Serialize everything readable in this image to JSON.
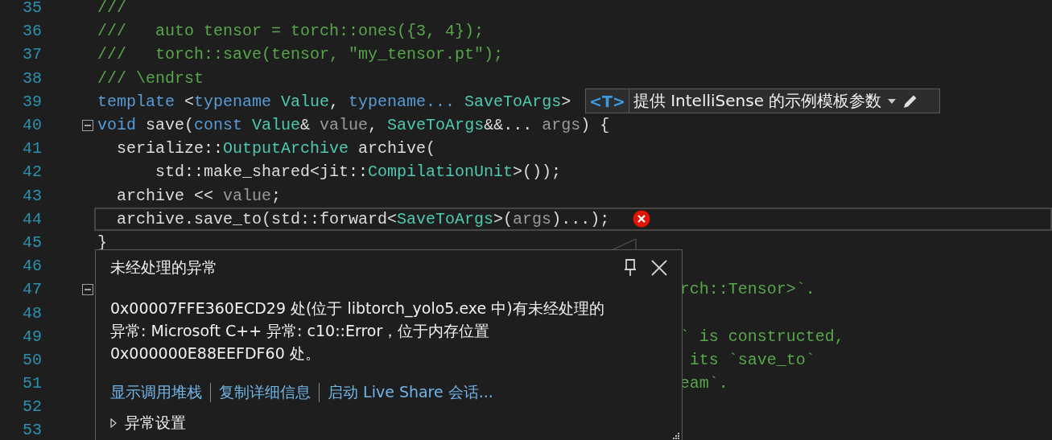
{
  "editor": {
    "lines": [
      {
        "number": "35",
        "current": false,
        "collapsible": false,
        "error": false,
        "tokens": [
          {
            "kind": "comment",
            "text": "///"
          }
        ]
      },
      {
        "number": "36",
        "current": false,
        "collapsible": false,
        "error": false,
        "tokens": [
          {
            "kind": "comment",
            "text": "///   auto tensor = torch::ones({3, 4});"
          }
        ]
      },
      {
        "number": "37",
        "current": false,
        "collapsible": false,
        "error": false,
        "tokens": [
          {
            "kind": "comment",
            "text": "///   torch::save(tensor, \"my_tensor.pt\");"
          }
        ]
      },
      {
        "number": "38",
        "current": false,
        "collapsible": false,
        "error": false,
        "tokens": [
          {
            "kind": "comment",
            "text": "/// \\endrst"
          }
        ]
      },
      {
        "number": "39",
        "current": false,
        "collapsible": false,
        "error": false,
        "tokens": [
          {
            "kind": "keyword",
            "text": "template"
          },
          {
            "kind": "plain",
            "text": " <"
          },
          {
            "kind": "keyword",
            "text": "typename"
          },
          {
            "kind": "type",
            "text": " Value"
          },
          {
            "kind": "plain",
            "text": ", "
          },
          {
            "kind": "keyword",
            "text": "typename..."
          },
          {
            "kind": "type",
            "text": " SaveToArgs"
          },
          {
            "kind": "plain",
            "text": ">"
          }
        ]
      },
      {
        "number": "40",
        "current": false,
        "collapsible": true,
        "error": false,
        "tokens": [
          {
            "kind": "keyword",
            "text": "void"
          },
          {
            "kind": "plain",
            "text": " save("
          },
          {
            "kind": "keyword",
            "text": "const"
          },
          {
            "kind": "type",
            "text": " Value"
          },
          {
            "kind": "plain",
            "text": "& "
          },
          {
            "kind": "param",
            "text": "value"
          },
          {
            "kind": "plain",
            "text": ", "
          },
          {
            "kind": "type",
            "text": "SaveToArgs"
          },
          {
            "kind": "plain",
            "text": "&&... "
          },
          {
            "kind": "param",
            "text": "args"
          },
          {
            "kind": "plain",
            "text": ") {"
          }
        ]
      },
      {
        "number": "41",
        "current": false,
        "collapsible": false,
        "error": false,
        "tokens": [
          {
            "kind": "plain",
            "text": "  serialize::"
          },
          {
            "kind": "type",
            "text": "OutputArchive"
          },
          {
            "kind": "plain",
            "text": " archive("
          }
        ]
      },
      {
        "number": "42",
        "current": false,
        "collapsible": false,
        "error": false,
        "tokens": [
          {
            "kind": "plain",
            "text": "      std::make_shared<jit::"
          },
          {
            "kind": "type",
            "text": "CompilationUnit"
          },
          {
            "kind": "plain",
            "text": ">());"
          }
        ]
      },
      {
        "number": "43",
        "current": false,
        "collapsible": false,
        "error": false,
        "tokens": [
          {
            "kind": "plain",
            "text": "  archive << "
          },
          {
            "kind": "param",
            "text": "value"
          },
          {
            "kind": "plain",
            "text": ";"
          }
        ]
      },
      {
        "number": "44",
        "current": true,
        "collapsible": false,
        "error": true,
        "tokens": [
          {
            "kind": "plain",
            "text": "  archive.save_to(std::forward<"
          },
          {
            "kind": "type",
            "text": "SaveToArgs"
          },
          {
            "kind": "plain",
            "text": ">("
          },
          {
            "kind": "param",
            "text": "args"
          },
          {
            "kind": "plain",
            "text": ")...);"
          }
        ]
      },
      {
        "number": "45",
        "current": false,
        "collapsible": false,
        "error": false,
        "tokens": [
          {
            "kind": "plain",
            "text": "}"
          }
        ]
      },
      {
        "number": "46",
        "current": false,
        "collapsible": false,
        "error": false
      },
      {
        "number": "47",
        "current": false,
        "collapsible": true,
        "error": false,
        "covered": true,
        "tokens": [
          {
            "kind": "comment",
            "text": "rch::Tensor>`."
          }
        ]
      },
      {
        "number": "48",
        "current": false,
        "collapsible": false,
        "error": false
      },
      {
        "number": "49",
        "current": false,
        "collapsible": false,
        "error": false,
        "covered": true,
        "tokens": [
          {
            "kind": "comment",
            "text": "` is constructed,"
          }
        ]
      },
      {
        "number": "50",
        "current": false,
        "collapsible": false,
        "error": false,
        "covered": true,
        "tokens": [
          {
            "kind": "comment",
            "text": " its `save_to`"
          }
        ]
      },
      {
        "number": "51",
        "current": false,
        "collapsible": false,
        "error": false,
        "covered": true,
        "tokens": [
          {
            "kind": "comment",
            "text": "eam`."
          }
        ]
      },
      {
        "number": "52",
        "current": false,
        "collapsible": false,
        "error": false
      },
      {
        "number": "53",
        "current": false,
        "collapsible": false,
        "error": false
      }
    ]
  },
  "template_hint": {
    "badge": "<T>",
    "label": "提供 IntelliSense 的示例模板参数"
  },
  "exception_popup": {
    "title": "未经处理的异常",
    "message_lines": [
      "0x00007FFE360ECD29 处(位于 libtorch_yolo5.exe 中)有未经处理的",
      "异常: Microsoft C++ 异常: c10::Error，位于内存位置",
      "0x000000E88EEFDF60 处。"
    ],
    "links": [
      "显示调用堆栈",
      "复制详细信息",
      "启动 Live Share 会话..."
    ],
    "settings": {
      "label": "异常设置",
      "expanded": false
    }
  }
}
